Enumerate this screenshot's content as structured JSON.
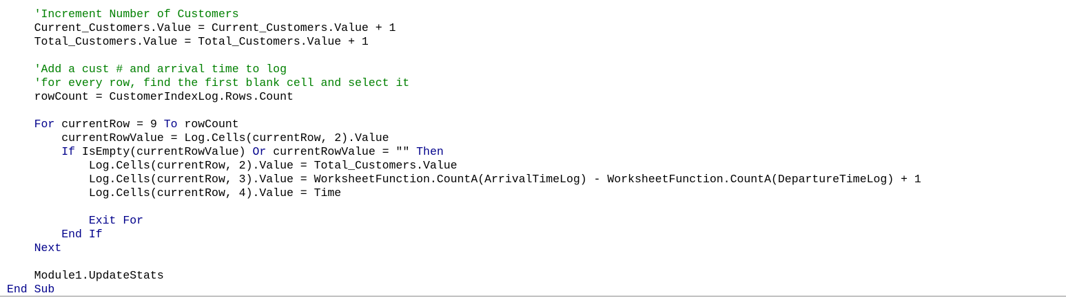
{
  "editor": {
    "colors": {
      "comment": "#008000",
      "keyword": "#00008b",
      "text": "#000000",
      "background": "#ffffff"
    },
    "lines": [
      {
        "indent": "    ",
        "segments": [
          {
            "t": "cmt",
            "v": "'Increment Number of Customers"
          }
        ]
      },
      {
        "indent": "    ",
        "segments": [
          {
            "t": "plain",
            "v": "Current_Customers.Value = Current_Customers.Value + 1"
          }
        ]
      },
      {
        "indent": "    ",
        "segments": [
          {
            "t": "plain",
            "v": "Total_Customers.Value = Total_Customers.Value + 1"
          }
        ]
      },
      {
        "indent": "",
        "segments": []
      },
      {
        "indent": "    ",
        "segments": [
          {
            "t": "cmt",
            "v": "'Add a cust # and arrival time to log"
          }
        ]
      },
      {
        "indent": "    ",
        "segments": [
          {
            "t": "cmt",
            "v": "'for every row, find the first blank cell and select it"
          }
        ]
      },
      {
        "indent": "    ",
        "segments": [
          {
            "t": "plain",
            "v": "rowCount = CustomerIndexLog.Rows.Count"
          }
        ]
      },
      {
        "indent": "",
        "segments": []
      },
      {
        "indent": "    ",
        "segments": [
          {
            "t": "kw",
            "v": "For"
          },
          {
            "t": "plain",
            "v": " currentRow = 9 "
          },
          {
            "t": "kw",
            "v": "To"
          },
          {
            "t": "plain",
            "v": " rowCount"
          }
        ]
      },
      {
        "indent": "        ",
        "segments": [
          {
            "t": "plain",
            "v": "currentRowValue = Log.Cells(currentRow, 2).Value"
          }
        ]
      },
      {
        "indent": "        ",
        "segments": [
          {
            "t": "kw",
            "v": "If"
          },
          {
            "t": "plain",
            "v": " IsEmpty(currentRowValue) "
          },
          {
            "t": "kw",
            "v": "Or"
          },
          {
            "t": "plain",
            "v": " currentRowValue = \"\" "
          },
          {
            "t": "kw",
            "v": "Then"
          }
        ]
      },
      {
        "indent": "            ",
        "segments": [
          {
            "t": "plain",
            "v": "Log.Cells(currentRow, 2).Value = Total_Customers.Value"
          }
        ]
      },
      {
        "indent": "            ",
        "segments": [
          {
            "t": "plain",
            "v": "Log.Cells(currentRow, 3).Value = WorksheetFunction.CountA(ArrivalTimeLog) - WorksheetFunction.CountA(DepartureTimeLog) + 1"
          }
        ]
      },
      {
        "indent": "            ",
        "segments": [
          {
            "t": "plain",
            "v": "Log.Cells(currentRow, 4).Value = Time"
          }
        ]
      },
      {
        "indent": "",
        "segments": []
      },
      {
        "indent": "            ",
        "segments": [
          {
            "t": "kw",
            "v": "Exit For"
          }
        ]
      },
      {
        "indent": "        ",
        "segments": [
          {
            "t": "kw",
            "v": "End If"
          }
        ]
      },
      {
        "indent": "    ",
        "segments": [
          {
            "t": "kw",
            "v": "Next"
          }
        ]
      },
      {
        "indent": "",
        "segments": []
      },
      {
        "indent": "    ",
        "segments": [
          {
            "t": "plain",
            "v": "Module1.UpdateStats"
          }
        ]
      },
      {
        "indent": "",
        "segments": [
          {
            "t": "kw",
            "v": "End Sub"
          }
        ]
      }
    ]
  }
}
